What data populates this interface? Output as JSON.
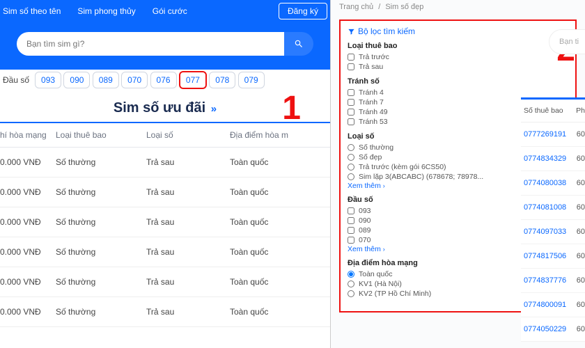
{
  "left": {
    "nav": [
      "Sim số theo tên",
      "Sim phong thủy",
      "Gói cước"
    ],
    "register": "Đăng ký",
    "search_placeholder": "Bạn tìm sim gì?",
    "prefix_label": "Đầu số",
    "prefixes": [
      "093",
      "090",
      "089",
      "070",
      "076",
      "077",
      "078",
      "079"
    ],
    "selected_prefix_index": 5,
    "promo_title": "Sim số ưu đãi",
    "annotation": "1",
    "table": {
      "headers": [
        "hí hòa mạng",
        "Loại thuê bao",
        "Loại số",
        "Địa điểm hòa m"
      ],
      "rows": [
        [
          "0.000 VNĐ",
          "Số thường",
          "Trả sau",
          "Toàn quốc"
        ],
        [
          "0.000 VNĐ",
          "Số thường",
          "Trả sau",
          "Toàn quốc"
        ],
        [
          "0.000 VNĐ",
          "Số thường",
          "Trả sau",
          "Toàn quốc"
        ],
        [
          "0.000 VNĐ",
          "Số thường",
          "Trả sau",
          "Toàn quốc"
        ],
        [
          "0.000 VNĐ",
          "Số thường",
          "Trả sau",
          "Toàn quốc"
        ],
        [
          "0.000 VNĐ",
          "Số thường",
          "Trả sau",
          "Toàn quốc"
        ]
      ]
    }
  },
  "right": {
    "breadcrumbs": [
      "Trang chủ",
      "Sim số đẹp"
    ],
    "annotation": "2",
    "search_fragment": "Bạn ti",
    "filter": {
      "title": "Bộ lọc tìm kiếm",
      "groups": [
        {
          "title": "Loại thuê bao",
          "type": "checkbox",
          "options": [
            "Trả trước",
            "Trả sau"
          ]
        },
        {
          "title": "Tránh số",
          "type": "checkbox",
          "options": [
            "Tránh 4",
            "Tránh 7",
            "Tránh 49",
            "Tránh 53"
          ]
        },
        {
          "title": "Loại số",
          "type": "radio",
          "options": [
            "Số thường",
            "Số đẹp",
            "Trả trước (kèm gói 6CS50)",
            "Sim lặp 3(ABCABC) (678678; 78978..."
          ],
          "seemore": "Xem thêm"
        },
        {
          "title": "Đầu số",
          "type": "checkbox",
          "options": [
            "093",
            "090",
            "089",
            "070"
          ],
          "seemore": "Xem thêm"
        },
        {
          "title": "Địa điểm hòa mạng",
          "type": "radio",
          "options": [
            "Toàn quốc",
            "KV1 (Hà Nội)",
            "KV2 (TP Hồ Chí Minh)"
          ],
          "checked_index": 0
        }
      ]
    },
    "table": {
      "header1": "Số thuê bao",
      "header2": "Ph",
      "col2frag": "60",
      "rows": [
        "0777269191",
        "0774834329",
        "0774080038",
        "0774081008",
        "0774097033",
        "0774817506",
        "0774837776",
        "0774800091",
        "0774050229"
      ]
    }
  }
}
